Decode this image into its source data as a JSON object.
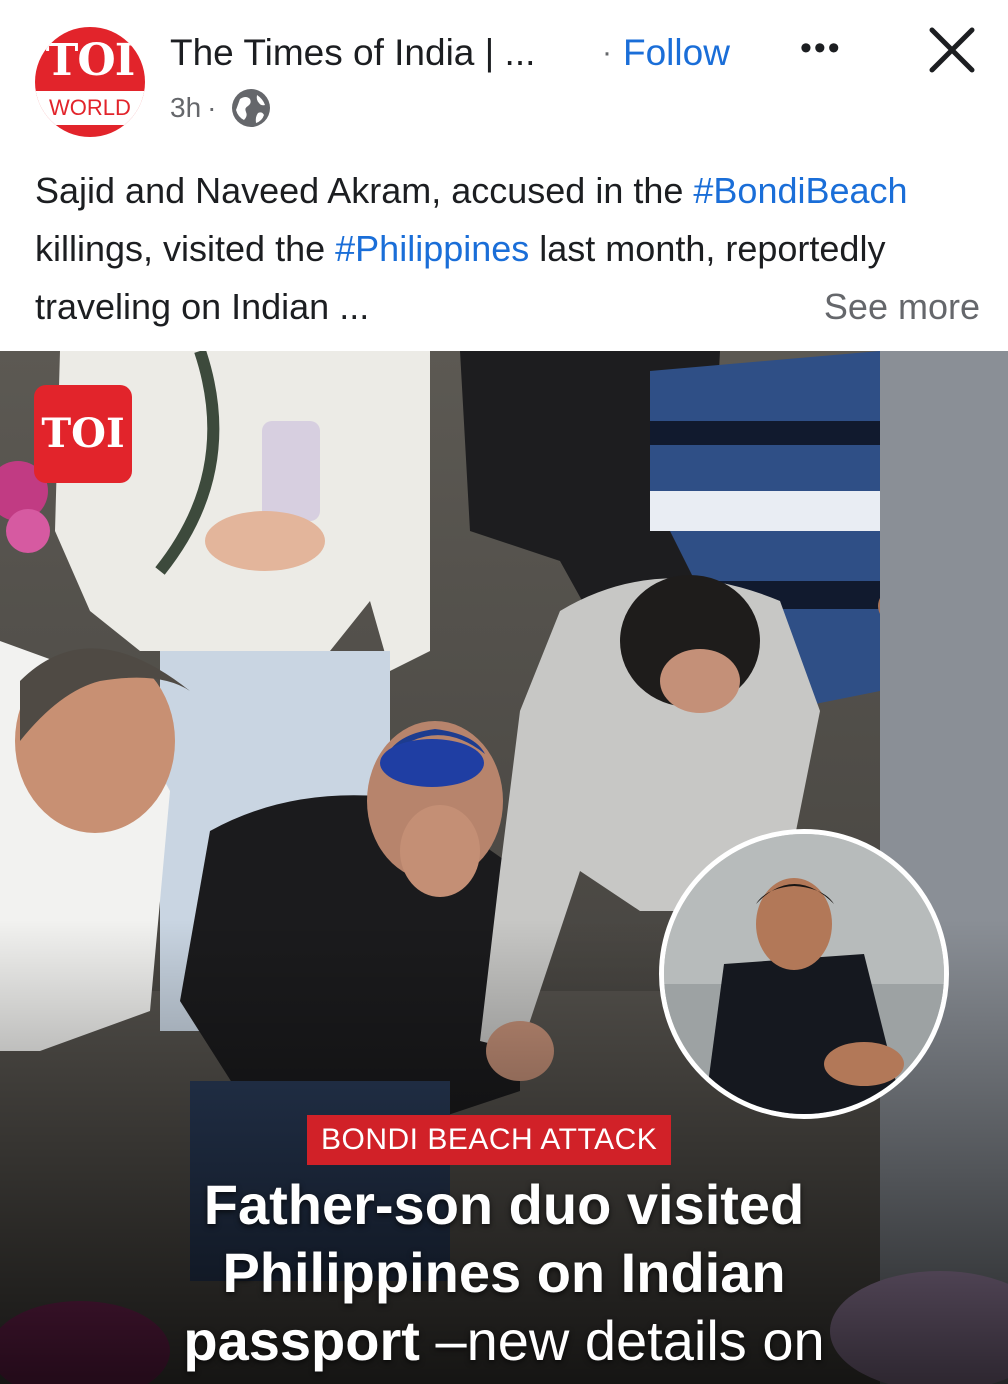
{
  "header": {
    "avatar_brand": "TOI",
    "avatar_sub": "WORLD",
    "page_name": "The Times of India | ...",
    "separator": "·",
    "follow_label": "Follow",
    "more_label": "•••",
    "timestamp": "3h",
    "meta_separator": "·",
    "audience_icon": "globe-icon",
    "close_icon": "close-icon"
  },
  "caption": {
    "t1": "Sajid and Naveed Akram, accused in the ",
    "tag1": "#BondiBeach",
    "t2": " killings, visited the ",
    "tag2": "#Philippines",
    "t3": " last month, reportedly traveling on Indian ...",
    "see_more": "See more"
  },
  "image": {
    "badge": "TOI",
    "kicker": "BONDI BEACH ATTACK",
    "headline_line1": "Father-son duo visited",
    "headline_line2": "Philippines on Indian",
    "headline_bold3": "passport",
    "headline_rest3": " –new details on"
  },
  "colors": {
    "brand_red": "#e2242b",
    "link_blue": "#1a6ed8",
    "kicker_red": "#d12128",
    "text": "#1c1e21",
    "muted": "#65676b"
  }
}
